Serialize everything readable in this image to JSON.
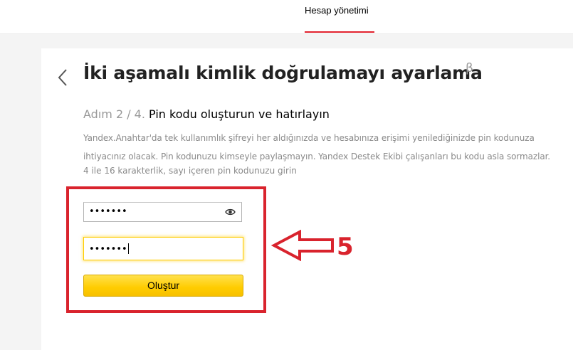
{
  "header": {
    "tab_label": "Hesap yönetimi"
  },
  "page": {
    "title": "İki aşamalı kimlik doğrulamayı ayarlama",
    "beta": "β"
  },
  "step": {
    "prefix": "Adım 2 / 4.",
    "title": "Pin kodu oluşturun ve hatırlayın"
  },
  "description": "Yandex.Anahtar'da tek kullanımlık şifreyi her aldığınızda ve hesabınıza erişimi yenilediğinizde pin kodunuza ihtiyacınız olacak. Pin kodunuzu kimseyle paylaşmayın. Yandex Destek Ekibi çalışanları bu kodu asla sormazlar.",
  "hint": "4 ile 16 karakterlik, sayı içeren pin kodunuzu girin",
  "form": {
    "pin_value": "•••••••",
    "pin_confirm_value": "•••••••",
    "submit_label": "Oluştur"
  },
  "annotation": {
    "number": "5"
  },
  "colors": {
    "accent_red": "#e2222e",
    "annotation_red": "#d9232d",
    "button_yellow": "#ffcc00"
  },
  "icons": {
    "back": "chevron-left-icon",
    "show_password": "eye-icon"
  }
}
